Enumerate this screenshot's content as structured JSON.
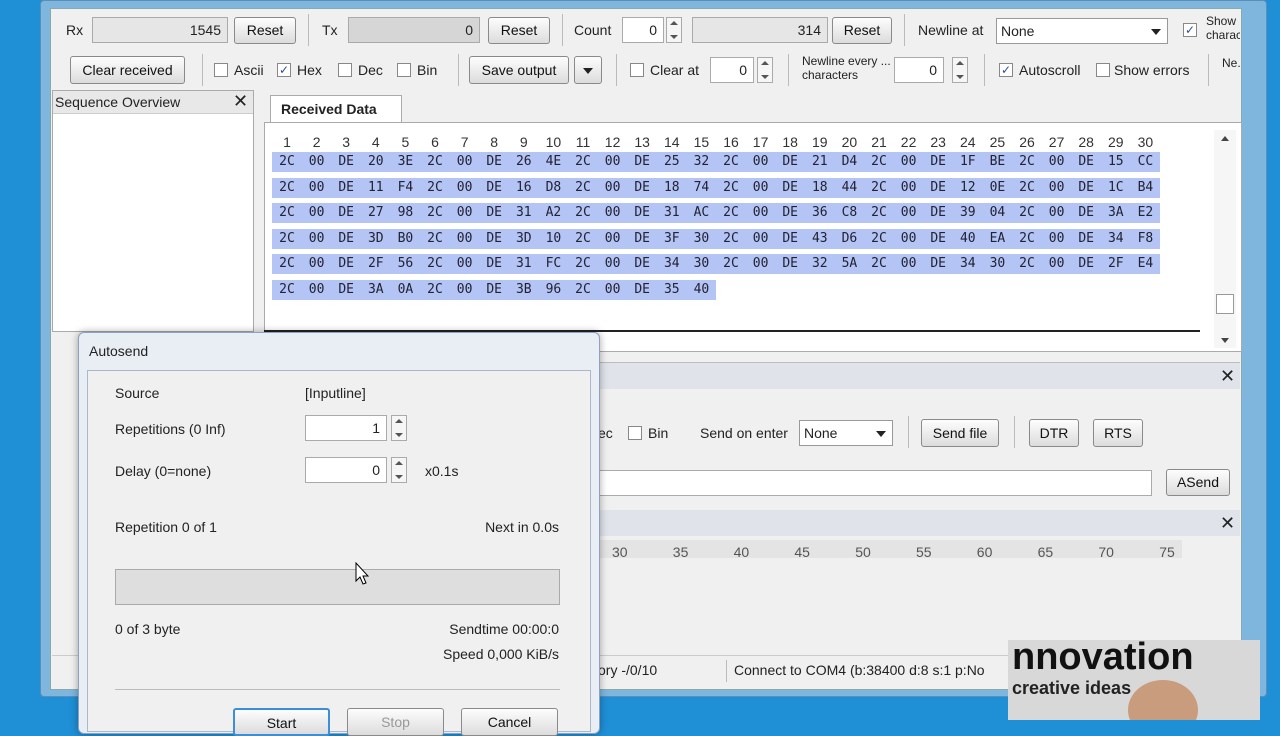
{
  "toolbar1": {
    "rx_label": "Rx",
    "rx_value": "1545",
    "reset1": "Reset",
    "tx_label": "Tx",
    "tx_value": "0",
    "reset2": "Reset",
    "count_label": "Count",
    "count_value": "0",
    "count_total": "314",
    "reset3": "Reset",
    "newline_label": "Newline at",
    "newline_value": "None",
    "show_chars": "Show characters"
  },
  "toolbar2": {
    "clear_received": "Clear received",
    "ascii": "Ascii",
    "hex": "Hex",
    "dec": "Dec",
    "bin": "Bin",
    "save_output": "Save output",
    "clear_at": "Clear at",
    "clear_at_value": "0",
    "newline_every": "Newline every ... characters",
    "newline_every_value": "0",
    "autoscroll": "Autoscroll",
    "show_errors": "Show errors",
    "ne": "Ne..."
  },
  "sequence_overview": {
    "title": "Sequence Overview"
  },
  "received": {
    "tab": "Received Data",
    "columns": [
      "1",
      "2",
      "3",
      "4",
      "5",
      "6",
      "7",
      "8",
      "9",
      "10",
      "11",
      "12",
      "13",
      "14",
      "15",
      "16",
      "17",
      "18",
      "19",
      "20",
      "21",
      "22",
      "23",
      "24",
      "25",
      "26",
      "27",
      "28",
      "29",
      "30"
    ],
    "rows": [
      [
        "2C",
        "00",
        "DE",
        "20",
        "3E",
        "2C",
        "00",
        "DE",
        "26",
        "4E",
        "2C",
        "00",
        "DE",
        "25",
        "32",
        "2C",
        "00",
        "DE",
        "21",
        "D4",
        "2C",
        "00",
        "DE",
        "1F",
        "BE",
        "2C",
        "00",
        "DE",
        "15",
        "CC"
      ],
      [
        "2C",
        "00",
        "DE",
        "11",
        "F4",
        "2C",
        "00",
        "DE",
        "16",
        "D8",
        "2C",
        "00",
        "DE",
        "18",
        "74",
        "2C",
        "00",
        "DE",
        "18",
        "44",
        "2C",
        "00",
        "DE",
        "12",
        "0E",
        "2C",
        "00",
        "DE",
        "1C",
        "B4"
      ],
      [
        "2C",
        "00",
        "DE",
        "27",
        "98",
        "2C",
        "00",
        "DE",
        "31",
        "A2",
        "2C",
        "00",
        "DE",
        "31",
        "AC",
        "2C",
        "00",
        "DE",
        "36",
        "C8",
        "2C",
        "00",
        "DE",
        "39",
        "04",
        "2C",
        "00",
        "DE",
        "3A",
        "E2"
      ],
      [
        "2C",
        "00",
        "DE",
        "3D",
        "B0",
        "2C",
        "00",
        "DE",
        "3D",
        "10",
        "2C",
        "00",
        "DE",
        "3F",
        "30",
        "2C",
        "00",
        "DE",
        "43",
        "D6",
        "2C",
        "00",
        "DE",
        "40",
        "EA",
        "2C",
        "00",
        "DE",
        "34",
        "F8"
      ],
      [
        "2C",
        "00",
        "DE",
        "2F",
        "56",
        "2C",
        "00",
        "DE",
        "31",
        "FC",
        "2C",
        "00",
        "DE",
        "34",
        "30",
        "2C",
        "00",
        "DE",
        "32",
        "5A",
        "2C",
        "00",
        "DE",
        "34",
        "30",
        "2C",
        "00",
        "DE",
        "2F",
        "E4"
      ],
      [
        "2C",
        "00",
        "DE",
        "3A",
        "0A",
        "2C",
        "00",
        "DE",
        "3B",
        "96",
        "2C",
        "00",
        "DE",
        "35",
        "40"
      ]
    ]
  },
  "send_panel": {
    "dec_partial": "ec",
    "bin": "Bin",
    "send_on_enter": "Send on enter",
    "send_on_enter_value": "None",
    "send_file": "Send file",
    "dtr": "DTR",
    "rts": "RTS",
    "asend": "ASend"
  },
  "ruler": {
    "ticks": [
      "30",
      "35",
      "40",
      "45",
      "50",
      "55",
      "60",
      "65",
      "70",
      "75"
    ]
  },
  "status": {
    "history": "ory -/0/10",
    "connection": "Connect to COM4 (b:38400 d:8 s:1 p:No"
  },
  "autosend": {
    "title": "Autosend",
    "source_label": "Source",
    "source_value": "[Inputline]",
    "repetitions_label": "Repetitions (0 Inf)",
    "repetitions_value": "1",
    "delay_label": "Delay (0=none)",
    "delay_value": "0",
    "delay_unit": "x0.1s",
    "repetition_status": "Repetition 0 of 1",
    "next_in": "Next in 0.0s",
    "progress": 0,
    "bytes": "0 of 3 byte",
    "sendtime": "Sendtime 00:00:0",
    "speed": "Speed 0,000 KiB/s",
    "start": "Start",
    "stop": "Stop",
    "cancel": "Cancel"
  },
  "webcam": {
    "text1": "nnovation",
    "text2": "creative ideas"
  },
  "colors": {
    "hex_bg": "#b4c4f4",
    "desktop": "#1f8fd6"
  }
}
